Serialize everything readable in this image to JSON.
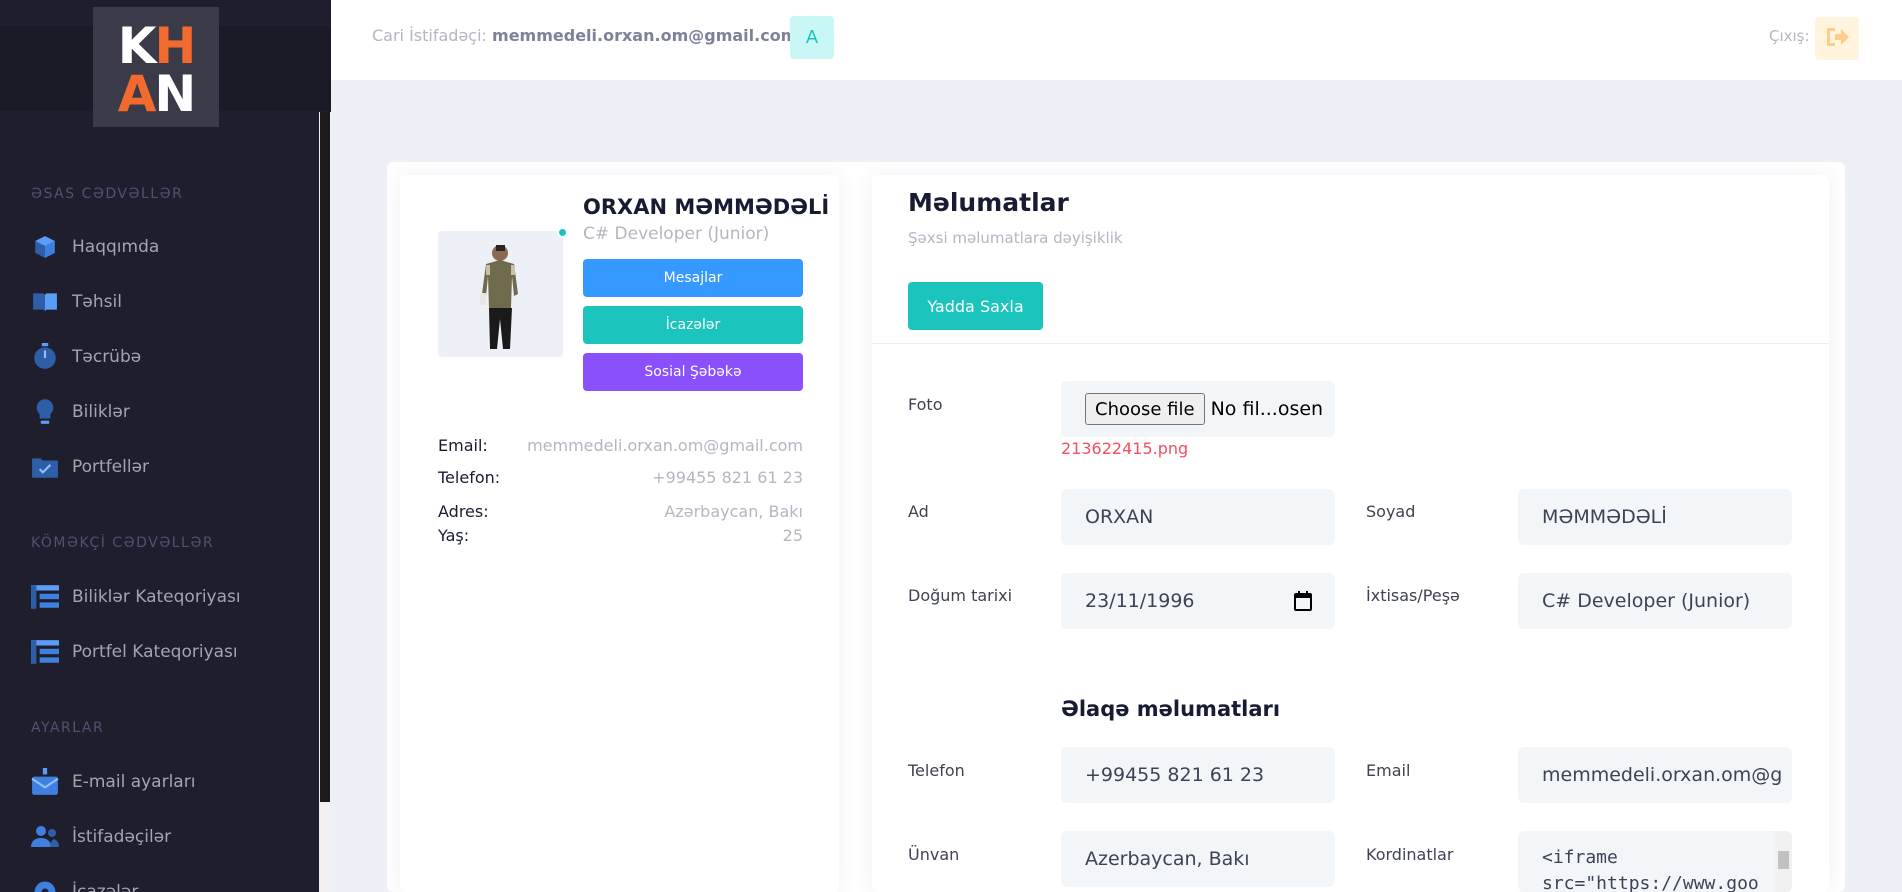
{
  "sidebar": {
    "logo": {
      "line1_white": "K",
      "line1_orange": "H",
      "line2_orange": "A",
      "line2_white": "N",
      "colors": {
        "white": "#ffffff",
        "orange": "#f26a2e"
      }
    },
    "sections": [
      {
        "title": "ƏSAS CƏDVƏLLƏR",
        "items": [
          {
            "label": "Haqqımda",
            "icon": "cube-icon"
          },
          {
            "label": "Təhsil",
            "icon": "book-icon"
          },
          {
            "label": "Təcrübə",
            "icon": "stopwatch-icon"
          },
          {
            "label": "Biliklər",
            "icon": "lightbulb-icon"
          },
          {
            "label": "Portfellər",
            "icon": "folder-check-icon"
          }
        ]
      },
      {
        "title": "KÖMƏKÇİ CƏDVƏLLƏR",
        "items": [
          {
            "label": "Biliklər Kateqoriyası",
            "icon": "list-icon"
          },
          {
            "label": "Portfel Kateqoriyası",
            "icon": "list-icon"
          }
        ]
      },
      {
        "title": "AYARLAR",
        "items": [
          {
            "label": "E-mail ayarları",
            "icon": "mail-icon"
          },
          {
            "label": "İstifadəçilər",
            "icon": "users-icon"
          },
          {
            "label": "İcazələr",
            "icon": "gear-icon"
          }
        ]
      }
    ]
  },
  "header": {
    "current_user_label": "Cari İstifadəçi:",
    "current_user_email": "memmedeli.orxan.om@gmail.com",
    "avatar_letter": "A",
    "logout_label": "Çıxış:"
  },
  "profile": {
    "name": "ORXAN MƏMMƏDƏLİ",
    "role": "C# Developer (Junior)",
    "buttons": {
      "messages": "Mesajlar",
      "permissions": "İcazələr",
      "social": "Sosial Şəbəkə"
    },
    "info": {
      "email_label": "Email:",
      "email_value": "memmedeli.orxan.om@gmail.com",
      "phone_label": "Telefon:",
      "phone_value": "+99455 821 61 23",
      "address_label": "Adres:",
      "address_value": "Azərbaycan, Bakı",
      "age_label": "Yaş:",
      "age_value": "25"
    }
  },
  "form": {
    "title": "Məlumatlar",
    "subtitle": "Şəxsi məlumatlara dəyişiklik",
    "save_button": "Yadda Saxla",
    "photo_label": "Foto",
    "file_button": "Choose file",
    "file_status": "No fil...osen",
    "file_name": "213622415.png",
    "name_label": "Ad",
    "name_value": "ORXAN",
    "surname_label": "Soyad",
    "surname_value": "MƏMMƏDƏLİ",
    "birth_label": "Doğum tarixi",
    "birth_value": "23/11/1996",
    "profession_label": "İxtisas/Peşə",
    "profession_value": "C# Developer (Junior)",
    "contact_heading": "Əlaqə məlumatları",
    "phone_label": "Telefon",
    "phone_value": "+99455 821 61 23",
    "email_label": "Email",
    "email_value": "memmedeli.orxan.om@g",
    "address_label": "Ünvan",
    "address_value": "Azerbaycan, Bakı",
    "coords_label": "Kordinatlar",
    "coords_line1": "<iframe",
    "coords_line2": "src=\"https://www.goo"
  }
}
